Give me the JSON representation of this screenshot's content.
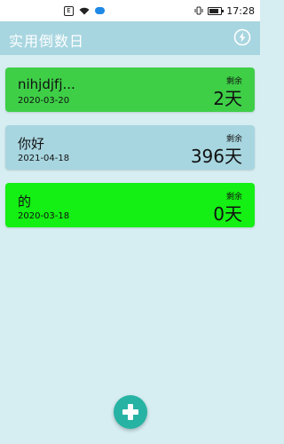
{
  "status_bar": {
    "time": "17:28",
    "sim_badge": "E",
    "icons": [
      "notification-icon",
      "wifi-icon",
      "cloud-icon",
      "vibrate-icon",
      "battery-icon"
    ],
    "battery_level": 0.8
  },
  "app_bar": {
    "title": "实用倒数日",
    "action_icon": "sort-icon"
  },
  "colors": {
    "background": "#d6eef2",
    "app_bar": "#a8d6e0",
    "card_green": "#3ecf47",
    "card_blue": "#a8d6e0",
    "card_bright_green": "#14ef14",
    "fab": "#26b3a3"
  },
  "countdowns": [
    {
      "name": "nihjdjfj...",
      "date": "2020-03-20",
      "remaining_label": "剩余",
      "days": "2天"
    },
    {
      "name": "你好",
      "date": "2021-04-18",
      "remaining_label": "剩余",
      "days": "396天"
    },
    {
      "name": "的",
      "date": "2020-03-18",
      "remaining_label": "剩余",
      "days": "0天"
    }
  ],
  "fab": {
    "icon": "plus-icon"
  }
}
